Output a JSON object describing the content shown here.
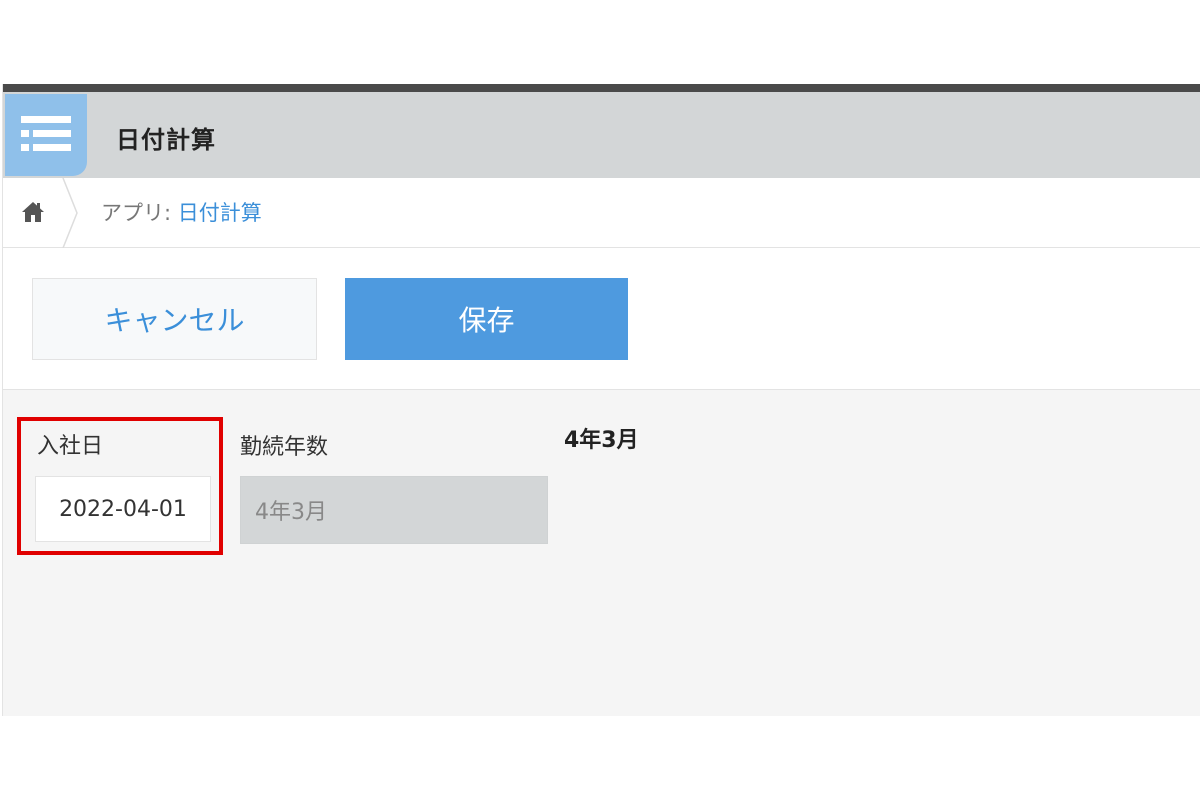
{
  "app": {
    "title": "日付計算",
    "icon": "list-icon"
  },
  "breadcrumb": {
    "home_icon": "home-icon",
    "prefix": "アプリ: ",
    "app_link": "日付計算"
  },
  "toolbar": {
    "cancel_label": "キャンセル",
    "save_label": "保存"
  },
  "form": {
    "hire_date": {
      "label": "入社日",
      "value": "2022-04-01"
    },
    "years_of_service": {
      "label": "勤続年数",
      "value": "4年3月"
    },
    "result_display": "4年3月"
  },
  "colors": {
    "accent": "#4e9adf",
    "link": "#3b8fd9",
    "header_bg": "#d3d6d7",
    "highlight": "#e00000"
  }
}
